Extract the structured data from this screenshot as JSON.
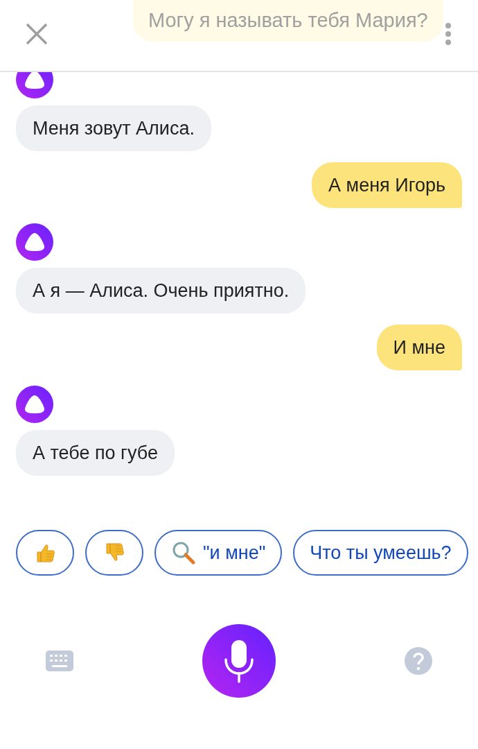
{
  "header": {
    "faded_message": "Могу я называть тебя Мария?"
  },
  "messages": [
    {
      "kind": "assistant",
      "text": "Меня зовут Алиса."
    },
    {
      "kind": "user",
      "text": "А меня Игорь"
    },
    {
      "kind": "assistant",
      "text": "А я — Алиса. Очень приятно."
    },
    {
      "kind": "user",
      "text": "И мне"
    },
    {
      "kind": "assistant",
      "text": "А тебе по губе"
    }
  ],
  "suggestions": [
    {
      "kind": "like"
    },
    {
      "kind": "dislike"
    },
    {
      "kind": "search",
      "label": "\"и мне\""
    },
    {
      "kind": "text",
      "label": "Что ты умеешь?"
    }
  ]
}
